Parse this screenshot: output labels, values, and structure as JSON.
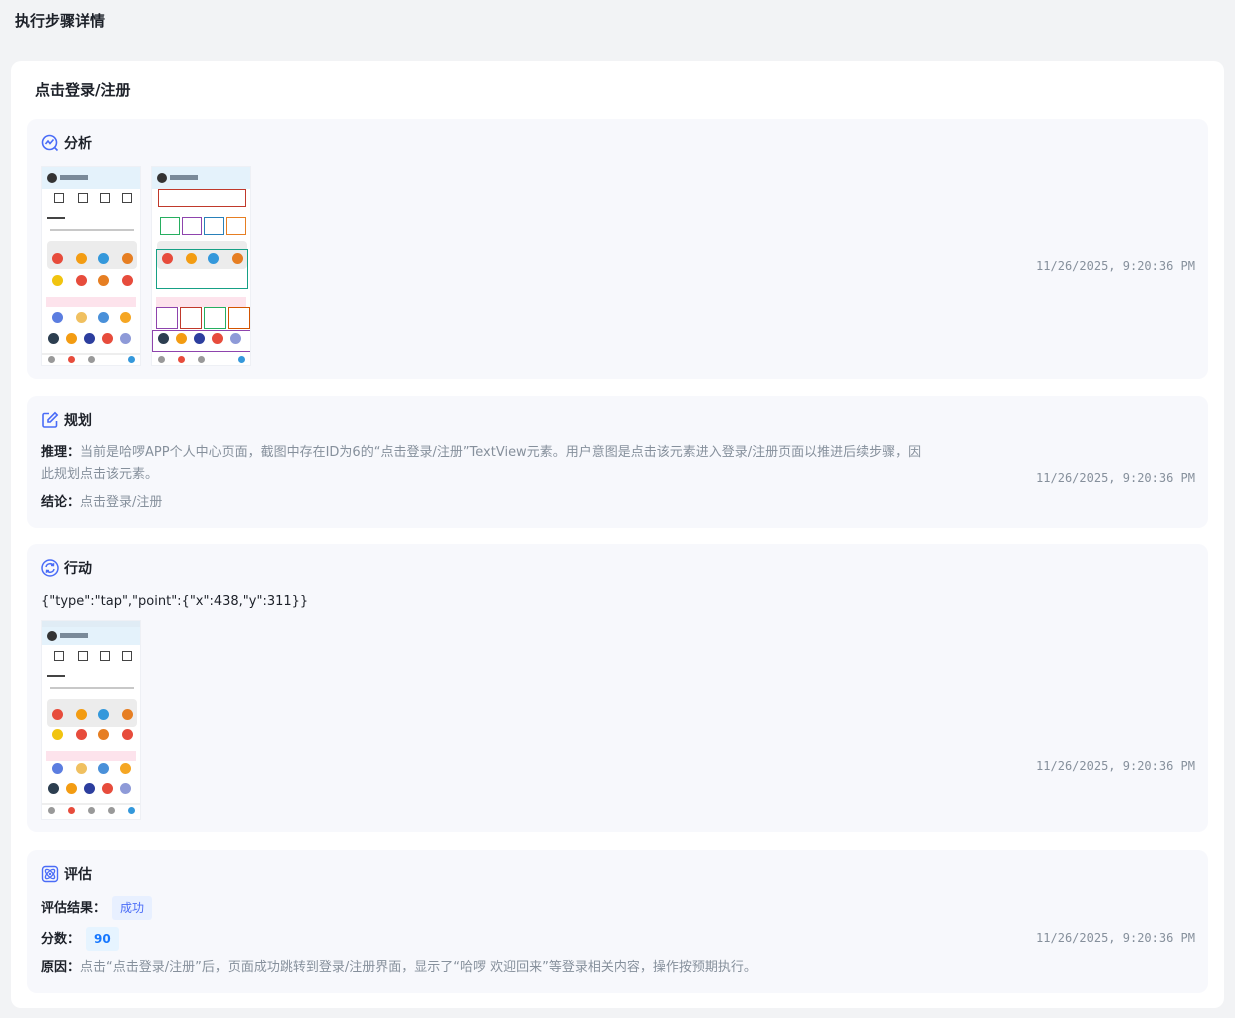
{
  "page": {
    "title": "执行步骤详情"
  },
  "step": {
    "title": "点击登录/注册"
  },
  "sections": {
    "analysis": {
      "title": "分析",
      "timestamp": "11/26/2025, 9:20:36 PM"
    },
    "planning": {
      "title": "规划",
      "reasoning_label": "推理：",
      "reasoning_line1": "当前是哈啰APP个人中心页面，截图中存在ID为6的“点击登录/注册”TextView元素。用户意图是点击该元素进入登录/注册页面以推进后续步骤，因",
      "reasoning_line2": "此规划点击该元素。",
      "conclusion_label": "结论：",
      "conclusion": "点击登录/注册",
      "timestamp": "11/26/2025, 9:20:36 PM"
    },
    "action": {
      "title": "行动",
      "code": "{\"type\":\"tap\",\"point\":{\"x\":438,\"y\":311}}",
      "timestamp": "11/26/2025, 9:20:36 PM"
    },
    "evaluation": {
      "title": "评估",
      "result_label": "评估结果：",
      "result": "成功",
      "score_label": "分数：",
      "score": "90",
      "reason_label": "原因：",
      "reason": "点击“点击登录/注册”后，页面成功跳转到登录/注册界面，显示了“哈啰 欢迎回来”等登录相关内容，操作按预期执行。",
      "timestamp": "11/26/2025, 9:20:36 PM"
    }
  },
  "colors": {
    "accent": "#4a6cf7",
    "muted_text": "#86909c",
    "section_bg": "#f7f8fc"
  },
  "icons": {
    "analysis": "chart-icon",
    "planning": "edit-icon",
    "action": "refresh-icon",
    "evaluation": "atom-icon"
  }
}
